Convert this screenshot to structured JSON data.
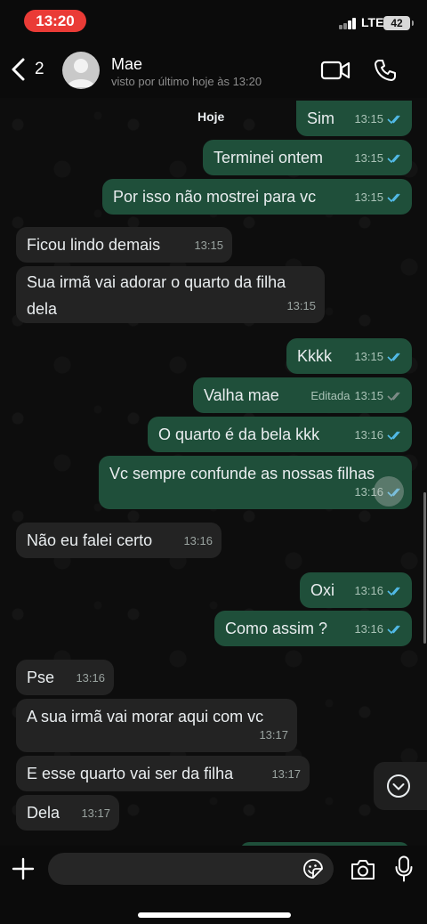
{
  "status_bar": {
    "time": "13:20",
    "network": "LTE",
    "battery": "42",
    "time_color": "#ea3b36"
  },
  "header": {
    "back_count": "2",
    "contact_name": "Mae",
    "contact_status": "visto por último hoje às 13:20"
  },
  "chat": {
    "day_label": "Hoje",
    "messages": [
      {
        "direction": "out",
        "text": "Sim",
        "time": "13:15",
        "edited": ""
      },
      {
        "direction": "out",
        "text": "Terminei ontem",
        "time": "13:15",
        "edited": ""
      },
      {
        "direction": "out",
        "text": "Por isso não mostrei para vc",
        "time": "13:15",
        "edited": ""
      },
      {
        "direction": "in",
        "text": "Ficou lindo demais",
        "time": "13:15",
        "edited": ""
      },
      {
        "direction": "in",
        "text": "Sua irmã vai adorar o quarto da filha dela",
        "line1": "Sua irmã vai adorar o quarto da filha",
        "line2": "dela",
        "time": "13:15",
        "edited": ""
      },
      {
        "direction": "out",
        "text": "Kkkk",
        "time": "13:15",
        "edited": ""
      },
      {
        "direction": "out",
        "text": "Valha mae",
        "time": "13:15",
        "edited": "Editada"
      },
      {
        "direction": "out",
        "text": "O quarto é da bela kkk",
        "time": "13:16",
        "edited": ""
      },
      {
        "direction": "out",
        "text": "Vc sempre confunde as nossas filhas",
        "time": "13:16",
        "edited": ""
      },
      {
        "direction": "in",
        "text": "Não eu falei certo",
        "time": "13:16",
        "edited": ""
      },
      {
        "direction": "out",
        "text": "Oxi",
        "time": "13:16",
        "edited": ""
      },
      {
        "direction": "out",
        "text": "Como assim ?",
        "time": "13:16",
        "edited": ""
      },
      {
        "direction": "in",
        "text": "Pse",
        "time": "13:16",
        "edited": ""
      },
      {
        "direction": "in",
        "text": "A sua irmã vai morar aqui com vc",
        "time": "13:17",
        "edited": ""
      },
      {
        "direction": "in",
        "text": "E esse quarto vai ser da filha",
        "time": "13:17",
        "edited": ""
      },
      {
        "direction": "in",
        "text": "Dela",
        "time": "13:17",
        "edited": ""
      }
    ]
  },
  "colors": {
    "incoming_bubble": "#232323",
    "outgoing_bubble": "#1f4f3a",
    "read_ticks": "#53bdeb"
  },
  "icons": [
    "chevron-left-icon",
    "avatar-placeholder-icon",
    "video-call-icon",
    "phone-icon",
    "chevron-down-circle-icon",
    "plus-icon",
    "sticker-icon",
    "camera-icon",
    "microphone-icon",
    "double-check-icon"
  ]
}
